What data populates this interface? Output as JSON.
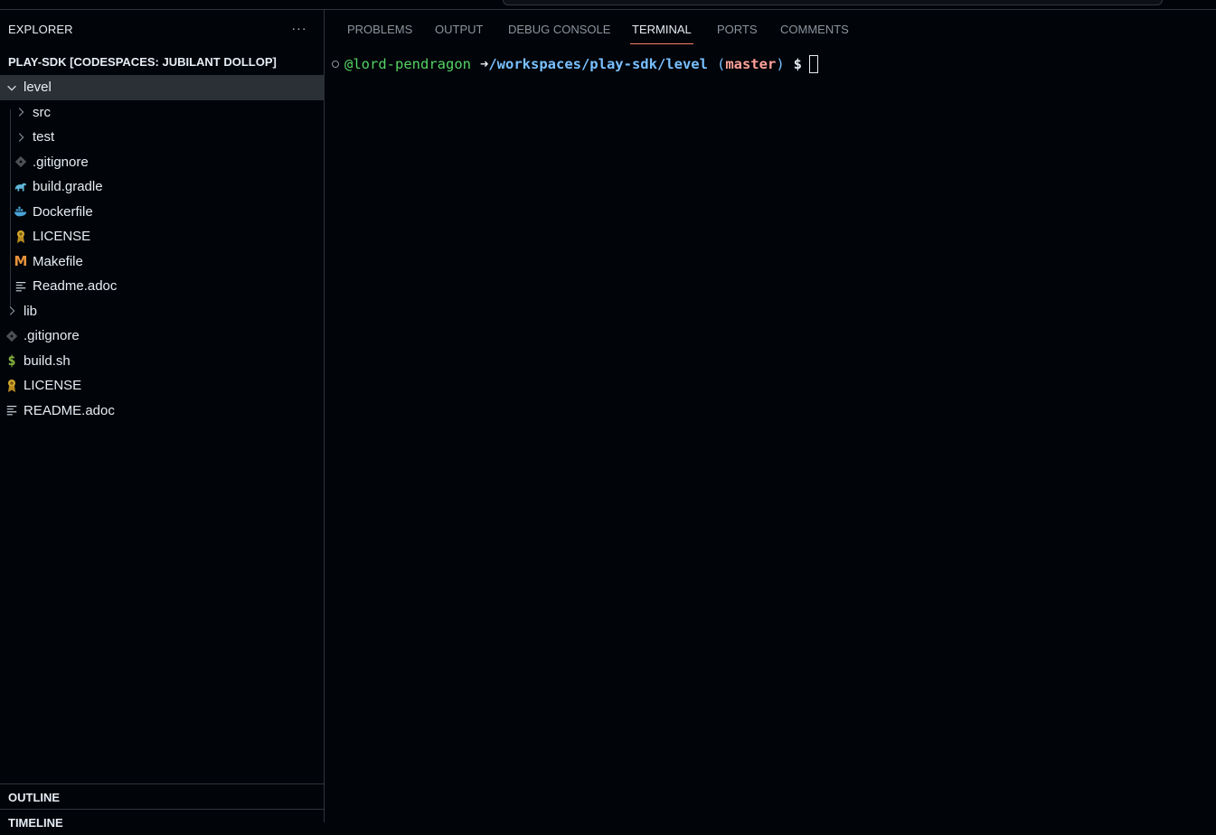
{
  "sidebar": {
    "header": "EXPLORER",
    "more": "···",
    "section_title": "PLAY-SDK [CODESPACES: JUBILANT DOLLOP]",
    "tree": [
      {
        "name": "level",
        "kind": "folder-open",
        "indent": 0,
        "icon": "chevron-down-icon",
        "selected": true
      },
      {
        "name": "src",
        "kind": "folder",
        "indent": 1,
        "icon": "chevron-right-icon"
      },
      {
        "name": "test",
        "kind": "folder",
        "indent": 1,
        "icon": "chevron-right-icon"
      },
      {
        "name": ".gitignore",
        "kind": "file",
        "indent": 1,
        "icon": "git-icon"
      },
      {
        "name": "build.gradle",
        "kind": "file",
        "indent": 1,
        "icon": "gradle-icon"
      },
      {
        "name": "Dockerfile",
        "kind": "file",
        "indent": 1,
        "icon": "docker-icon"
      },
      {
        "name": "LICENSE",
        "kind": "file",
        "indent": 1,
        "icon": "license-icon"
      },
      {
        "name": "Makefile",
        "kind": "file",
        "indent": 1,
        "icon": "makefile-icon"
      },
      {
        "name": "Readme.adoc",
        "kind": "file",
        "indent": 1,
        "icon": "text-lines-icon"
      },
      {
        "name": "lib",
        "kind": "folder",
        "indent": 0,
        "icon": "chevron-right-icon"
      },
      {
        "name": ".gitignore",
        "kind": "file",
        "indent": 0,
        "icon": "git-icon"
      },
      {
        "name": "build.sh",
        "kind": "file",
        "indent": 0,
        "icon": "shell-icon"
      },
      {
        "name": "LICENSE",
        "kind": "file",
        "indent": 0,
        "icon": "license-icon"
      },
      {
        "name": "README.adoc",
        "kind": "file",
        "indent": 0,
        "icon": "text-lines-icon"
      }
    ],
    "outline": "OUTLINE",
    "timeline": "TIMELINE"
  },
  "panel": {
    "tabs": [
      {
        "label": "PROBLEMS",
        "active": false
      },
      {
        "label": "OUTPUT",
        "active": false
      },
      {
        "label": "DEBUG CONSOLE",
        "active": false
      },
      {
        "label": "TERMINAL",
        "active": true
      },
      {
        "label": "PORTS",
        "active": false
      },
      {
        "label": "COMMENTS",
        "active": false
      }
    ],
    "terminal": {
      "user": "@lord-pendragon",
      "arrow": "➜",
      "path": "/workspaces/play-sdk/level",
      "paren_open": "(",
      "branch": "master",
      "paren_close": ")",
      "prompt": "$"
    }
  },
  "colors": {
    "background": "#010409",
    "accent_tab": "#f78166",
    "user": "#56d364",
    "path": "#79c0ff",
    "branch": "#ffa198"
  }
}
